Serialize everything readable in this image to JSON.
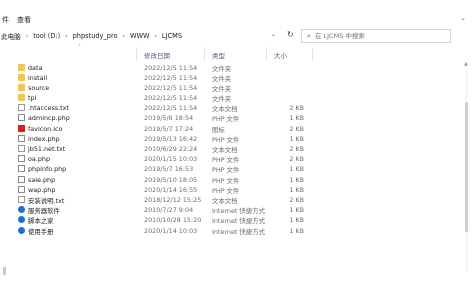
{
  "ribbon": {
    "tab1": "件",
    "tab2": "查看",
    "expand_icon": "chevron-down-icon"
  },
  "address": {
    "crumbs": [
      "此电脑",
      "tool (D:)",
      "phpstudy_pro",
      "WWW",
      "LJCMS"
    ],
    "separator": "›"
  },
  "search": {
    "placeholder": "在 LJCMS 中搜索"
  },
  "columns": {
    "date": "修改日期",
    "type": "类型",
    "size": "大小"
  },
  "files": [
    {
      "name": "data",
      "date": "2022/12/5 11:54",
      "type": "文件夹",
      "size": "",
      "icon": "folder-icon"
    },
    {
      "name": "install",
      "date": "2022/12/5 11:54",
      "type": "文件夹",
      "size": "",
      "icon": "folder-icon"
    },
    {
      "name": "source",
      "date": "2022/12/5 11:54",
      "type": "文件夹",
      "size": "",
      "icon": "folder-icon"
    },
    {
      "name": "tpl",
      "date": "2022/12/5 11:54",
      "type": "文件夹",
      "size": "",
      "icon": "folder-icon"
    },
    {
      "name": ".htaccess.txt",
      "date": "2022/12/5 11:54",
      "type": "文本文档",
      "size": "2 KB",
      "icon": "text-file-icon"
    },
    {
      "name": "admincp.php",
      "date": "2019/5/6 18:54",
      "type": "PHP 文件",
      "size": "1 KB",
      "icon": "php-file-icon"
    },
    {
      "name": "favicon.ico",
      "date": "2019/5/7 17:24",
      "type": "图标",
      "size": "2 KB",
      "icon": "ico-file-icon"
    },
    {
      "name": "index.php",
      "date": "2019/5/13 16:42",
      "type": "PHP 文件",
      "size": "1 KB",
      "icon": "php-file-icon"
    },
    {
      "name": "jb51.net.txt",
      "date": "2010/6/29 22:24",
      "type": "文本文档",
      "size": "2 KB",
      "icon": "text-file-icon"
    },
    {
      "name": "oa.php",
      "date": "2020/1/15 10:03",
      "type": "PHP 文件",
      "size": "2 KB",
      "icon": "php-file-icon"
    },
    {
      "name": "phpinfo.php",
      "date": "2019/5/7 16:53",
      "type": "PHP 文件",
      "size": "1 KB",
      "icon": "php-file-icon"
    },
    {
      "name": "sale.php",
      "date": "2019/5/10 18:05",
      "type": "PHP 文件",
      "size": "1 KB",
      "icon": "php-file-icon"
    },
    {
      "name": "wap.php",
      "date": "2020/1/14 16:55",
      "type": "PHP 文件",
      "size": "1 KB",
      "icon": "php-file-icon"
    },
    {
      "name": "安装说明.txt",
      "date": "2018/12/12 15:25",
      "type": "文本文档",
      "size": "2 KB",
      "icon": "text-file-icon"
    },
    {
      "name": "服务器软件",
      "date": "2010/7/27 9:04",
      "type": "Internet 快捷方式",
      "size": "1 KB",
      "icon": "internet-shortcut-icon"
    },
    {
      "name": "脚本之家",
      "date": "2010/10/28 15:20",
      "type": "Internet 快捷方式",
      "size": "1 KB",
      "icon": "internet-shortcut-icon"
    },
    {
      "name": "使用手册",
      "date": "2020/1/14 10:03",
      "type": "Internet 快捷方式",
      "size": "1 KB",
      "icon": "internet-shortcut-icon"
    }
  ]
}
